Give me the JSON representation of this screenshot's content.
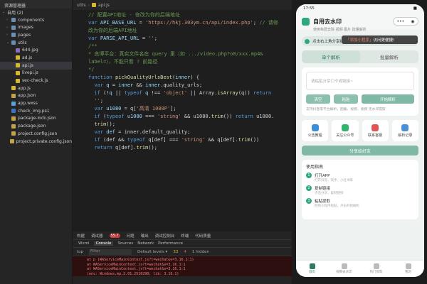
{
  "tree": {
    "header": "资源管理器",
    "section": "自用 (2)",
    "items": [
      {
        "label": "components",
        "kind": "folder",
        "indent": 1,
        "chev": "›"
      },
      {
        "label": "images",
        "kind": "folder",
        "indent": 1,
        "chev": "›"
      },
      {
        "label": "pages",
        "kind": "folder",
        "indent": 1,
        "chev": "›"
      },
      {
        "label": "utils",
        "kind": "folder",
        "indent": 1,
        "chev": "⌄"
      },
      {
        "label": "644.jpg",
        "kind": "img",
        "indent": 2,
        "chev": ""
      },
      {
        "label": "ad.js",
        "kind": "js",
        "indent": 2,
        "chev": ""
      },
      {
        "label": "api.js",
        "kind": "js",
        "indent": 2,
        "chev": "",
        "active": true
      },
      {
        "label": "livepi.js",
        "kind": "js",
        "indent": 2,
        "chev": ""
      },
      {
        "label": "sec-check.js",
        "kind": "js",
        "indent": 2,
        "chev": ""
      },
      {
        "label": "app.js",
        "kind": "js",
        "indent": 1,
        "chev": ""
      },
      {
        "label": "app.json",
        "kind": "json",
        "indent": 1,
        "chev": ""
      },
      {
        "label": "app.wxss",
        "kind": "wxss",
        "indent": 1,
        "chev": ""
      },
      {
        "label": "check_img.ps1",
        "kind": "ps",
        "indent": 1,
        "chev": ""
      },
      {
        "label": "package-lock.json",
        "kind": "json",
        "indent": 1,
        "chev": ""
      },
      {
        "label": "package.json",
        "kind": "json",
        "indent": 1,
        "chev": ""
      },
      {
        "label": "project.config.json",
        "kind": "json",
        "indent": 1,
        "chev": ""
      },
      {
        "label": "project.private.config.json",
        "kind": "json",
        "indent": 1,
        "chev": ""
      }
    ]
  },
  "editor": {
    "breadcrumb_root": "utils",
    "breadcrumb_file": "api.js",
    "line_numbers": [],
    "code": [
      {
        "html_parts": [
          [
            "cm",
            "// 配置API地址 - 修改为你的后端地址"
          ]
        ]
      },
      {
        "html_parts": [
          [
            "kw",
            "var "
          ],
          [
            "var",
            "API_BASE_URL"
          ],
          [
            "pl",
            " = "
          ],
          [
            "str",
            "'https://hkj.303ym.cn/api/index.php'"
          ],
          [
            "pl",
            "; "
          ],
          [
            "cm",
            "// 请修"
          ]
        ]
      },
      {
        "html_parts": [
          [
            "cm",
            "改为你的后端API地址"
          ]
        ]
      },
      {
        "html_parts": [
          [
            "pl",
            ""
          ]
        ]
      },
      {
        "html_parts": [
          [
            "kw",
            "var "
          ],
          [
            "var",
            "PARSE_API_URL"
          ],
          [
            "pl",
            " = "
          ],
          [
            "str",
            "''"
          ],
          [
            "pl",
            ";"
          ]
        ]
      },
      {
        "html_parts": [
          [
            "pl",
            ""
          ]
        ],
        "hl": true
      },
      {
        "html_parts": [
          [
            "cm",
            "/**"
          ]
        ]
      },
      {
        "html_parts": [
          [
            "cm",
            "* 良博平台：真实文件名在 query 里（如 .../video.php?o0/xxx.mp4&"
          ]
        ]
      },
      {
        "html_parts": [
          [
            "cm",
            "label=），不能只看 ? 前路径"
          ]
        ]
      },
      {
        "html_parts": [
          [
            "cm",
            "*/"
          ]
        ]
      },
      {
        "html_parts": [
          [
            "kw",
            "function "
          ],
          [
            "fn",
            "pickQualityUrlsBest"
          ],
          [
            "pl",
            "("
          ],
          [
            "var",
            "inner"
          ],
          [
            "pl",
            ") {"
          ]
        ]
      },
      {
        "html_parts": [
          [
            "pl",
            "  "
          ],
          [
            "kw",
            "var "
          ],
          [
            "var",
            "q"
          ],
          [
            "pl",
            " = "
          ],
          [
            "var",
            "inner"
          ],
          [
            "pl",
            " && "
          ],
          [
            "var",
            "inner"
          ],
          [
            "pl",
            ".quality_urls;"
          ]
        ]
      },
      {
        "html_parts": [
          [
            "pl",
            "  "
          ],
          [
            "kw",
            "if "
          ],
          [
            "pl",
            "(!"
          ],
          [
            "var",
            "q"
          ],
          [
            "pl",
            " || "
          ],
          [
            "kw",
            "typeof "
          ],
          [
            "var",
            "q"
          ],
          [
            "pl",
            " !== "
          ],
          [
            "str",
            "'object'"
          ],
          [
            "pl",
            " || Array."
          ],
          [
            "fn",
            "isArray"
          ],
          [
            "pl",
            "(q)) "
          ],
          [
            "kw",
            "return"
          ]
        ]
      },
      {
        "html_parts": [
          [
            "pl",
            "  "
          ],
          [
            "str",
            "''"
          ],
          [
            "pl",
            ";"
          ]
        ]
      },
      {
        "html_parts": [
          [
            "pl",
            "  "
          ],
          [
            "kw",
            "var "
          ],
          [
            "var",
            "u1080"
          ],
          [
            "pl",
            " = q["
          ],
          [
            "str",
            "'高清 1080P'"
          ],
          [
            "pl",
            "];"
          ]
        ]
      },
      {
        "html_parts": [
          [
            "pl",
            "  "
          ],
          [
            "kw",
            "if "
          ],
          [
            "pl",
            "("
          ],
          [
            "kw",
            "typeof "
          ],
          [
            "var",
            "u1080"
          ],
          [
            "pl",
            " === "
          ],
          [
            "str",
            "'string'"
          ],
          [
            "pl",
            " && u1080."
          ],
          [
            "fn",
            "trim"
          ],
          [
            "pl",
            "()) "
          ],
          [
            "kw",
            "return "
          ],
          [
            "pl",
            "u1080."
          ]
        ]
      },
      {
        "html_parts": [
          [
            "pl",
            "  "
          ],
          [
            "fn",
            "trim"
          ],
          [
            "pl",
            "();"
          ]
        ]
      },
      {
        "html_parts": [
          [
            "pl",
            "  "
          ],
          [
            "kw",
            "var "
          ],
          [
            "var",
            "def"
          ],
          [
            "pl",
            " = inner.default_quality;"
          ]
        ]
      },
      {
        "html_parts": [
          [
            "pl",
            "  "
          ],
          [
            "kw",
            "if "
          ],
          [
            "pl",
            "(def && "
          ],
          [
            "kw",
            "typeof "
          ],
          [
            "pl",
            "q[def] === "
          ],
          [
            "str",
            "'string'"
          ],
          [
            "pl",
            " && q[def]."
          ],
          [
            "fn",
            "trim"
          ],
          [
            "pl",
            "())"
          ]
        ]
      },
      {
        "html_parts": [
          [
            "pl",
            "  "
          ],
          [
            "kw",
            "return "
          ],
          [
            "pl",
            "q[def]."
          ],
          [
            "fn",
            "trim"
          ],
          [
            "pl",
            "();"
          ]
        ]
      }
    ]
  },
  "bottom": {
    "tabs": [
      "构建",
      "调试器",
      "问题",
      "输出",
      "调试控制台",
      "终端",
      "代码质量"
    ],
    "debug_badge": "55.7",
    "devtools_tabs": [
      "Wxml",
      "Console",
      "Sources",
      "Network",
      "Performance"
    ],
    "warn_count": "33",
    "err_count": "4",
    "filter_scope": "top",
    "filter_placeholder": "Filter",
    "levels": "Default levels ▾",
    "hidden": "1 hidden",
    "errors": [
      "at p (WAServiceMainContext.js?t=wechat&v=3.16.1:1)",
      "at WAServiceMainContext.js?t=wechat&v=3.16.1:1",
      "at WAServiceMainContext.js?t=wechat&v=3.16.1:1",
      "(env: Windows,mp,2.01.2510290; lib: 3.16.1)"
    ]
  },
  "phone": {
    "time": "17:55",
    "battery": "■",
    "app_title": "自用去水印",
    "subtitle": "使用免费去除 视频 图片 批量解析",
    "capsule_more": "•••",
    "capsule_close": "◉",
    "toast_prefix": "「添加小程序」",
    "toast_suffix": "访问更便捷!",
    "notice": "点击右上角分享给好友一起玩吧",
    "seg_single": "单个解析",
    "seg_batch": "批量解析",
    "input_placeholder": "请粘贴分享口令或链接~",
    "btn_clear": "清空",
    "btn_paste": "粘贴",
    "btn_parse": "开始解析",
    "hint": "支持抖音等平台解析，图集、视频、视频 无水印提取",
    "quick": [
      {
        "label": "公告教程",
        "color": "#3a8fd8"
      },
      {
        "label": "关注公众号",
        "color": "#33b36b"
      },
      {
        "label": "联系客服",
        "color": "#e25555"
      },
      {
        "label": "解析记录",
        "color": "#4a90d9"
      }
    ],
    "share_btn": "分享给好友",
    "guide_title": "使用指南",
    "steps": [
      {
        "n": "1",
        "t": "打开APP",
        "d": "打开抖音、快手、小红书等"
      },
      {
        "n": "2",
        "t": "复制链接",
        "d": "点击分享，复制链接"
      },
      {
        "n": "3",
        "t": "粘贴提取",
        "d": "回到小程序粘贴，点击开始解析"
      }
    ],
    "tabbar": [
      {
        "label": "首页",
        "on": true
      },
      {
        "label": "视频去水印",
        "on": false
      },
      {
        "label": "热门资料",
        "on": false
      },
      {
        "label": "我的",
        "on": false
      }
    ]
  }
}
